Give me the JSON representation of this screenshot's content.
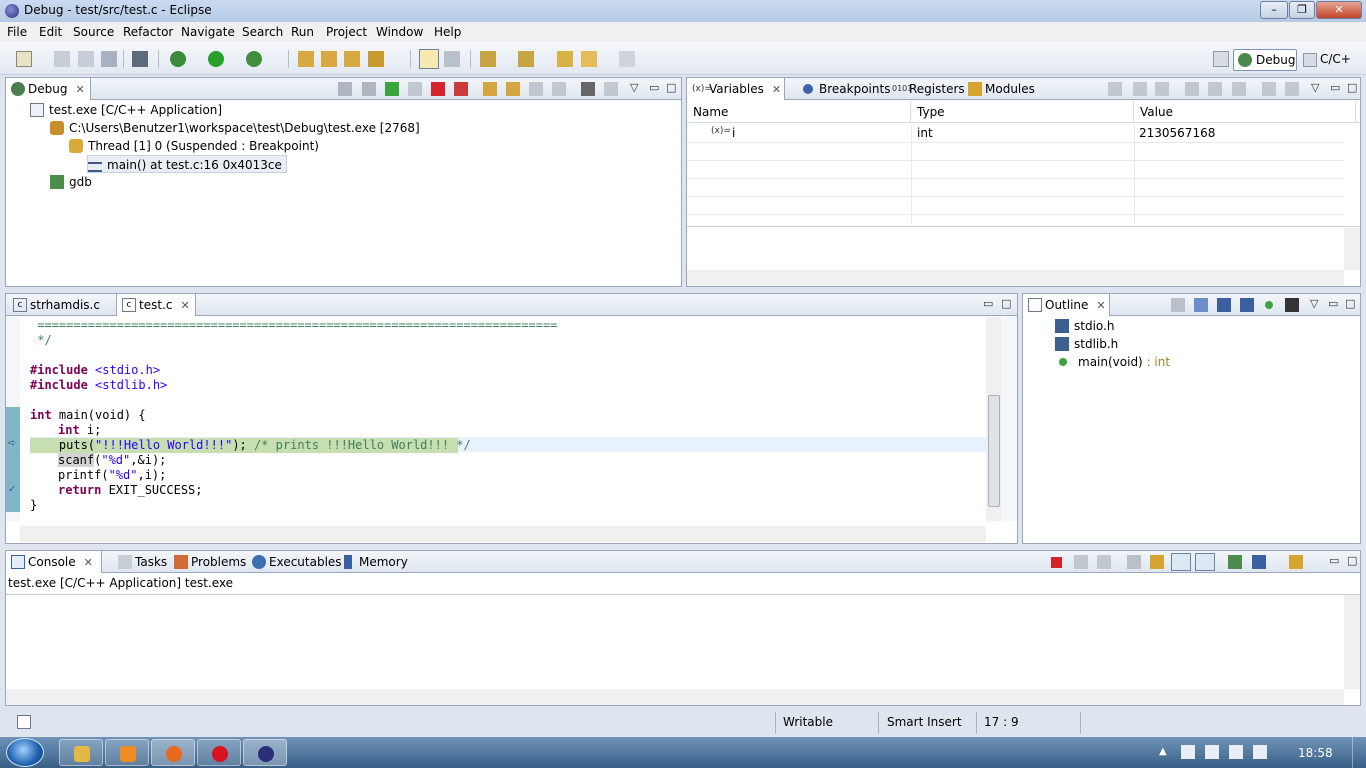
{
  "window": {
    "title": "Debug - test/src/test.c - Eclipse"
  },
  "menu": [
    "File",
    "Edit",
    "Source",
    "Refactor",
    "Navigate",
    "Search",
    "Run",
    "Project",
    "Window",
    "Help"
  ],
  "perspectives": {
    "debug": "Debug",
    "cpp": "C/C+"
  },
  "debug_view": {
    "tab": "Debug",
    "tree": [
      {
        "label": "test.exe [C/C++ Application]",
        "icon": "c-app-icon"
      },
      {
        "label": "C:\\Users\\Benutzer1\\workspace\\test\\Debug\\test.exe [2768]",
        "icon": "process-icon"
      },
      {
        "label": "Thread [1] 0 (Suspended : Breakpoint)",
        "icon": "thread-icon"
      },
      {
        "label": "main() at test.c:16 0x4013ce",
        "icon": "stack-frame-icon"
      },
      {
        "label": "gdb",
        "icon": "gdb-icon"
      }
    ]
  },
  "variables_view": {
    "tabs": [
      "Variables",
      "Breakpoints",
      "Registers",
      "Modules"
    ],
    "columns": [
      "Name",
      "Type",
      "Value"
    ],
    "rows": [
      {
        "name": "i",
        "type": "int",
        "value": "2130567168"
      }
    ]
  },
  "editor": {
    "tabs": [
      "strhamdis.c",
      "test.c"
    ],
    "lines": {
      "sep": " ========================================================================",
      "endcmt": " */",
      "inc1_kw": "#include",
      "inc1_path": " <stdio.h>",
      "inc2_kw": "#include",
      "inc2_path": " <stdlib.h>",
      "main_kw": "int",
      "main_rest": " main(void) {",
      "decl_kw": "int",
      "decl_rest": " i;",
      "puts_fn": "puts(",
      "puts_str": "\"!!!Hello World!!!\"",
      "puts_end": "); ",
      "puts_cmt": "/* prints !!!Hello World!!! */",
      "scanf_fn": "scanf",
      "scanf_open": "(",
      "scanf_str": "\"%d\"",
      "scanf_rest": ",&i);",
      "printf_fn": "printf(",
      "printf_str": "\"%d\"",
      "printf_rest": ",i);",
      "ret_kw": "return",
      "ret_rest": " EXIT_SUCCESS;",
      "close": "}"
    }
  },
  "outline_view": {
    "tab": "Outline",
    "items": [
      {
        "label": "stdio.h",
        "type": ""
      },
      {
        "label": "stdlib.h",
        "type": ""
      },
      {
        "label": "main(void)",
        "type": " : int"
      }
    ]
  },
  "bottom_view": {
    "tabs": [
      "Console",
      "Tasks",
      "Problems",
      "Executables",
      "Memory"
    ],
    "console_title": "test.exe [C/C++ Application] test.exe"
  },
  "status": {
    "writable": "Writable",
    "insert": "Smart Insert",
    "position": "17 : 9"
  },
  "taskbar": {
    "clock": "18:58"
  }
}
